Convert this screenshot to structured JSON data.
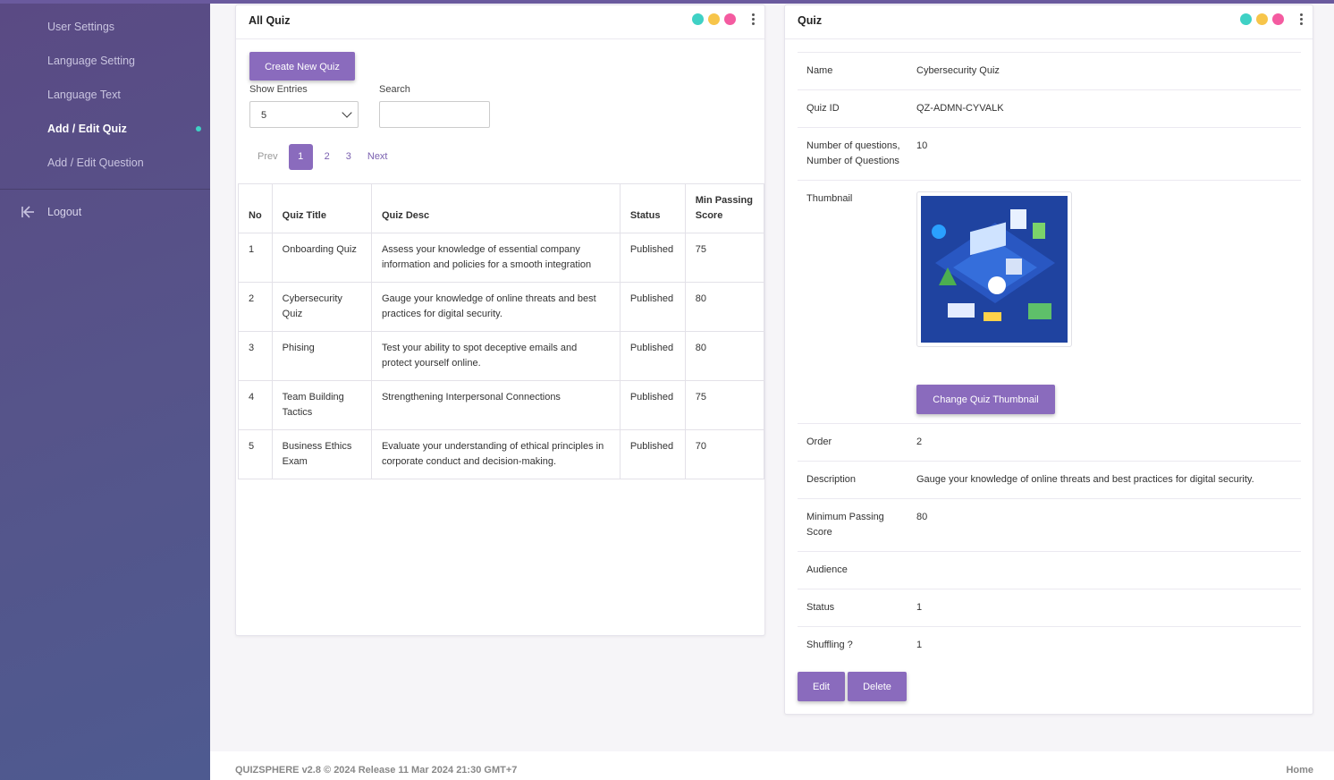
{
  "sidebar": {
    "items": [
      {
        "label": "User Settings"
      },
      {
        "label": "Language Setting"
      },
      {
        "label": "Language Text"
      },
      {
        "label": "Add / Edit Quiz"
      },
      {
        "label": "Add / Edit Question"
      }
    ],
    "active_index": 3,
    "logout_label": "Logout",
    "logout_icon": "logout-icon"
  },
  "all_quiz": {
    "title": "All Quiz",
    "create_button": "Create New Quiz",
    "show_entries_label": "Show Entries",
    "show_entries_value": "5",
    "search_label": "Search",
    "search_value": "",
    "pagination": {
      "prev": "Prev",
      "pages": [
        "1",
        "2",
        "3"
      ],
      "active": "1",
      "next": "Next"
    },
    "table": {
      "headers": [
        "No",
        "Quiz Title",
        "Quiz Desc",
        "Status",
        "Min Passing Score"
      ],
      "rows": [
        [
          "1",
          "Onboarding Quiz",
          "Assess your knowledge of essential company information and policies for a smooth integration",
          "Published",
          "75"
        ],
        [
          "2",
          "Cybersecurity Quiz",
          "Gauge your knowledge of online threats and best practices for digital security.",
          "Published",
          "80"
        ],
        [
          "3",
          "Phising",
          "Test your ability to spot deceptive emails and protect yourself online.",
          "Published",
          "80"
        ],
        [
          "4",
          "Team Building Tactics",
          "Strengthening Interpersonal Connections",
          "Published",
          "75"
        ],
        [
          "5",
          "Business Ethics Exam",
          "Evaluate your understanding of ethical principles in corporate conduct and decision-making.",
          "Published",
          "70"
        ]
      ]
    }
  },
  "quiz_detail": {
    "title": "Quiz",
    "fields": {
      "name": {
        "label": "Name",
        "value": "Cybersecurity Quiz"
      },
      "quiz_id": {
        "label": "Quiz ID",
        "value": "QZ-ADMN-CYVALK"
      },
      "num_questions": {
        "label": "Number of questions, Number of Questions",
        "value": "10"
      },
      "thumbnail": {
        "label": "Thumbnail"
      },
      "order": {
        "label": "Order",
        "value": "2"
      },
      "description": {
        "label": "Description",
        "value": "Gauge your knowledge of online threats and best practices for digital security."
      },
      "min_passing": {
        "label": "Minimum Passing Score",
        "value": "80"
      },
      "audience": {
        "label": "Audience",
        "value": ""
      },
      "status": {
        "label": "Status",
        "value": "1"
      },
      "shuffling": {
        "label": "Shuffling ?",
        "value": "1"
      }
    },
    "change_thumbnail_button": "Change Quiz Thumbnail",
    "edit_button": "Edit",
    "delete_button": "Delete"
  },
  "header_dots": [
    "#3fd1c5",
    "#f7c54a",
    "#f45ba0"
  ],
  "colors": {
    "accent": "#8a6bbd",
    "sidebar": "#56548a"
  },
  "footer": {
    "left": "QUIZSPHERE v2.8 © 2024 Release 11 Mar 2024 21:30 GMT+7",
    "right": "Home"
  }
}
